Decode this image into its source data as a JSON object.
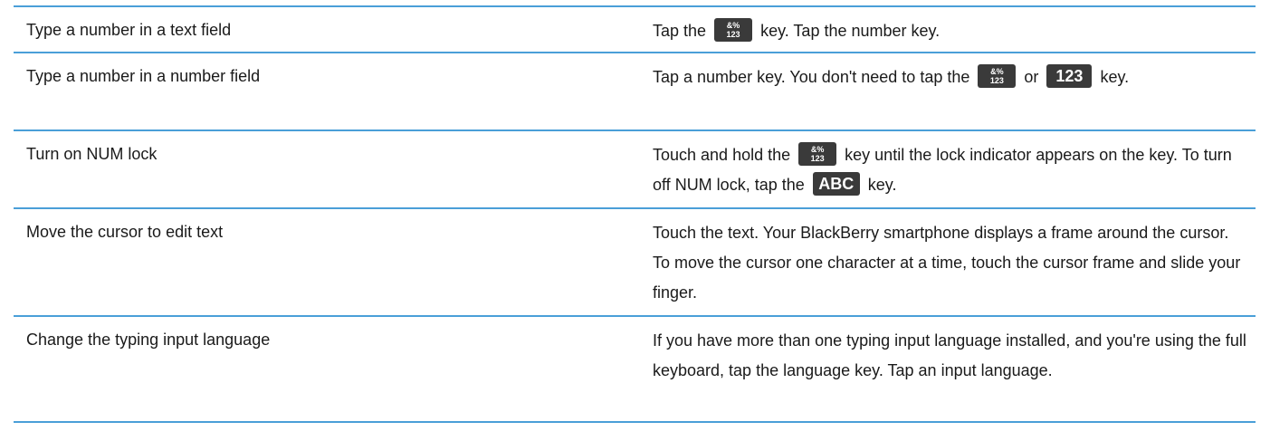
{
  "rows": [
    {
      "action": "Type a number in a text field",
      "desc": {
        "p1": "Tap the",
        "p2": "key. Tap the number key."
      }
    },
    {
      "action": "Type a number in a number field",
      "desc": {
        "p1": "Tap a number key. You don't need to tap the",
        "p2": "or",
        "p3": "key."
      }
    },
    {
      "action": "Turn on NUM lock",
      "desc": {
        "p1": "Touch and hold the",
        "p2": "key until the lock indicator appears on the key. To turn off NUM lock, tap the",
        "p3": "key."
      }
    },
    {
      "action": "Move the cursor to edit text",
      "desc": {
        "p1": "Touch the text. Your BlackBerry smartphone displays a frame around the cursor. To move the cursor one character at a time, touch the cursor frame and slide your finger."
      }
    },
    {
      "action": "Change the typing input language",
      "desc": {
        "p1": "If you have more than one typing input language installed, and you're using the full keyboard, tap the language key. Tap an input language."
      }
    }
  ],
  "keys": {
    "sym_top": "&%",
    "sym_bottom": "123",
    "num": "123",
    "abc": "ABC"
  },
  "colors": {
    "rule": "#4a9fd8",
    "key_bg": "#3a3a3a",
    "key_text": "#ffffff"
  }
}
